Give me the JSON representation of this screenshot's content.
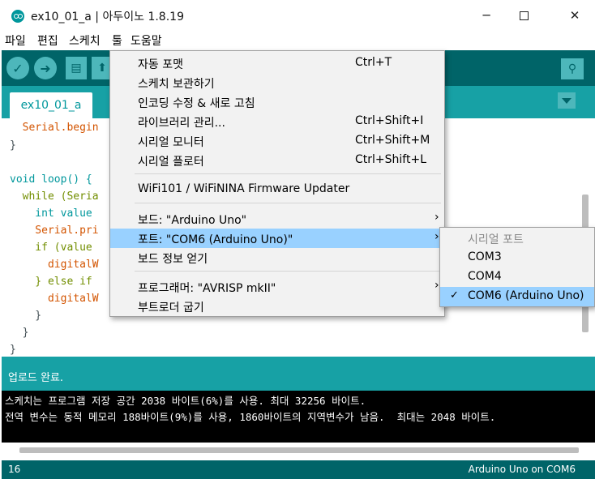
{
  "window": {
    "title": "ex10_01_a | 아두이노 1.8.19",
    "accent": "#00979c"
  },
  "menubar": {
    "items": [
      "파일",
      "편집",
      "스케치",
      "툴",
      "도움말"
    ]
  },
  "toolbar": {
    "verify_icon": "✓",
    "upload_icon": "➜",
    "new_icon": "▤",
    "open_icon": "⬆",
    "serial_monitor_icon": "⚲"
  },
  "tabs": {
    "active_label": "ex10_01_a"
  },
  "editor": {
    "lines": [
      "  Serial.begin",
      "}",
      "",
      "void loop() {",
      "  while (Seria",
      "    int value",
      "    Serial.pri",
      "    if (value",
      "      digitalW",
      "    } else if",
      "      digitalW",
      "    }",
      "  }",
      "}"
    ]
  },
  "tools_menu": {
    "items": [
      {
        "label": "자동 포맷",
        "shortcut": "Ctrl+T"
      },
      {
        "label": "스케치 보관하기",
        "shortcut": ""
      },
      {
        "label": "인코딩 수정 & 새로 고침",
        "shortcut": ""
      },
      {
        "label": "라이브러리 관리...",
        "shortcut": "Ctrl+Shift+I"
      },
      {
        "label": "시리얼 모니터",
        "shortcut": "Ctrl+Shift+M"
      },
      {
        "label": "시리얼 플로터",
        "shortcut": "Ctrl+Shift+L"
      },
      {
        "label": "WiFi101 / WiFiNINA Firmware Updater",
        "shortcut": ""
      },
      {
        "label": "보드: \"Arduino Uno\"",
        "shortcut": ""
      },
      {
        "label": "포트: \"COM6 (Arduino Uno)\"",
        "shortcut": ""
      },
      {
        "label": "보드 정보 얻기",
        "shortcut": ""
      },
      {
        "label": "프로그래머: \"AVRISP mkII\"",
        "shortcut": ""
      },
      {
        "label": "부트로더 굽기",
        "shortcut": ""
      }
    ],
    "submenu_arrow": "›"
  },
  "port_submenu": {
    "header": "시리얼 포트",
    "ports": [
      "COM3",
      "COM4",
      "COM6 (Arduino Uno)"
    ],
    "selected_index": 2,
    "check_mark": "✓"
  },
  "status": {
    "message": "업로드 완료."
  },
  "console": {
    "lines": [
      "스케치는 프로그램 저장 공간 2038 바이트(6%)를 사용. 최대 32256 바이트.",
      "전역 변수는 동적 메모리 188바이트(9%)를 사용, 1860바이트의 지역변수가 남음.  최대는 2048 바이트."
    ]
  },
  "footer": {
    "line_number": "16",
    "board_port": "Arduino Uno on COM6"
  }
}
